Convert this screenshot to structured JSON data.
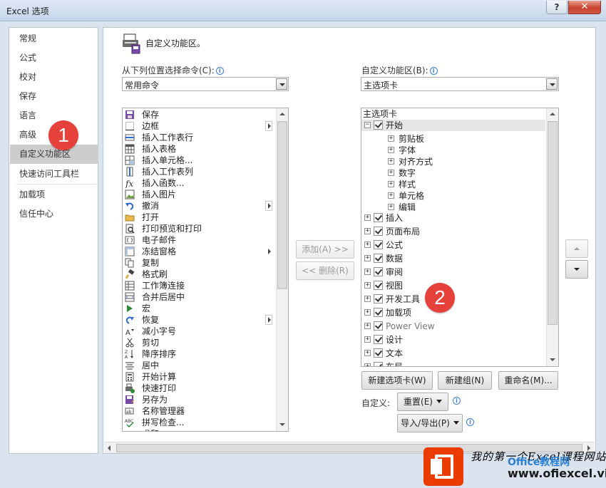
{
  "window": {
    "title": "Excel 选项",
    "help_label": "?",
    "close_label": "✕"
  },
  "nav": {
    "items": [
      {
        "label": "常规",
        "selected": false
      },
      {
        "label": "公式",
        "selected": false
      },
      {
        "label": "校对",
        "selected": false
      },
      {
        "label": "保存",
        "selected": false
      },
      {
        "label": "语言",
        "selected": false
      },
      {
        "label": "高级",
        "selected": false
      },
      {
        "label": "自定义功能区",
        "selected": true
      },
      {
        "label": "快速访问工具栏",
        "selected": false
      },
      {
        "label": "加载项",
        "selected": false
      },
      {
        "label": "信任中心",
        "selected": false
      }
    ]
  },
  "header": {
    "title": "自定义功能区。"
  },
  "left": {
    "label": "从下列位置选择命令(C):",
    "selected_source": "常用命令",
    "commands": [
      {
        "label": "保存",
        "icon": "save-icon",
        "submenu": false
      },
      {
        "label": "边框",
        "icon": "border-icon",
        "submenu": true
      },
      {
        "label": "插入工作表行",
        "icon": "insert-row-icon",
        "submenu": false
      },
      {
        "label": "插入表格",
        "icon": "table-icon",
        "submenu": false
      },
      {
        "label": "插入单元格...",
        "icon": "insert-cell-icon",
        "submenu": false
      },
      {
        "label": "插入工作表列",
        "icon": "insert-column-icon",
        "submenu": false
      },
      {
        "label": "插入函数...",
        "icon": "function-icon",
        "submenu": false
      },
      {
        "label": "插入图片",
        "icon": "picture-icon",
        "submenu": false
      },
      {
        "label": "撤消",
        "icon": "undo-icon",
        "submenu": true
      },
      {
        "label": "打开",
        "icon": "open-folder-icon",
        "submenu": false
      },
      {
        "label": "打印预览和打印",
        "icon": "print-preview-icon",
        "submenu": false
      },
      {
        "label": "电子邮件",
        "icon": "email-icon",
        "submenu": false
      },
      {
        "label": "冻结窗格",
        "icon": "freeze-panes-icon",
        "submenu": "arrow"
      },
      {
        "label": "复制",
        "icon": "copy-icon",
        "submenu": false
      },
      {
        "label": "格式刷",
        "icon": "format-painter-icon",
        "submenu": false
      },
      {
        "label": "工作簿连接",
        "icon": "connections-icon",
        "submenu": false
      },
      {
        "label": "合并后居中",
        "icon": "merge-center-icon",
        "submenu": false
      },
      {
        "label": "宏",
        "icon": "macro-icon",
        "submenu": false
      },
      {
        "label": "恢复",
        "icon": "redo-icon",
        "submenu": true
      },
      {
        "label": "减小字号",
        "icon": "decrease-font-icon",
        "submenu": false
      },
      {
        "label": "剪切",
        "icon": "cut-icon",
        "submenu": false
      },
      {
        "label": "降序排序",
        "icon": "sort-desc-icon",
        "submenu": false
      },
      {
        "label": "居中",
        "icon": "center-align-icon",
        "submenu": false
      },
      {
        "label": "开始计算",
        "icon": "calculate-icon",
        "submenu": false
      },
      {
        "label": "快速打印",
        "icon": "quick-print-icon",
        "submenu": false
      },
      {
        "label": "另存为",
        "icon": "save-as-icon",
        "submenu": false
      },
      {
        "label": "名称管理器",
        "icon": "name-manager-icon",
        "submenu": false
      },
      {
        "label": "拼写检查...",
        "icon": "spelling-icon",
        "submenu": false
      },
      {
        "label": "求和",
        "icon": "sum-icon",
        "submenu": false
      }
    ]
  },
  "middle": {
    "add_label": "添加(A) >>",
    "remove_label": "<< 删除(R)"
  },
  "right": {
    "label": "自定义功能区(B):",
    "selected_scope": "主选项卡",
    "tree_header": "主选项卡",
    "tree": [
      {
        "label": "开始",
        "level": 0,
        "expand": "−",
        "checked": true,
        "highlight": true
      },
      {
        "label": "剪贴板",
        "level": 1,
        "expand": "+",
        "checked": null
      },
      {
        "label": "字体",
        "level": 1,
        "expand": "+",
        "checked": null
      },
      {
        "label": "对齐方式",
        "level": 1,
        "expand": "+",
        "checked": null
      },
      {
        "label": "数字",
        "level": 1,
        "expand": "+",
        "checked": null
      },
      {
        "label": "样式",
        "level": 1,
        "expand": "+",
        "checked": null
      },
      {
        "label": "单元格",
        "level": 1,
        "expand": "+",
        "checked": null
      },
      {
        "label": "编辑",
        "level": 1,
        "expand": "+",
        "checked": null
      },
      {
        "label": "插入",
        "level": 0,
        "expand": "+",
        "checked": true
      },
      {
        "label": "页面布局",
        "level": 0,
        "expand": "+",
        "checked": true
      },
      {
        "label": "公式",
        "level": 0,
        "expand": "+",
        "checked": true
      },
      {
        "label": "数据",
        "level": 0,
        "expand": "+",
        "checked": true
      },
      {
        "label": "审阅",
        "level": 0,
        "expand": "+",
        "checked": true
      },
      {
        "label": "视图",
        "level": 0,
        "expand": "+",
        "checked": true
      },
      {
        "label": "开发工具",
        "level": 0,
        "expand": "+",
        "checked": true
      },
      {
        "label": "加载项",
        "level": 0,
        "expand": "+",
        "checked": true
      },
      {
        "label": "Power View",
        "level": 0,
        "expand": "+",
        "checked": true,
        "faded": true
      },
      {
        "label": "设计",
        "level": 0,
        "expand": "+",
        "checked": true
      },
      {
        "label": "文本",
        "level": 0,
        "expand": "+",
        "checked": true
      },
      {
        "label": "布局",
        "level": 0,
        "expand": "+",
        "checked": true
      }
    ],
    "new_tab_label": "新建选项卡(W)",
    "new_group_label": "新建组(N)",
    "rename_label": "重命名(M)...",
    "customize_label": "自定义:",
    "reset_label": "重置(E)",
    "import_export_label": "导入/导出(P)"
  },
  "annotations": {
    "badge1": "1",
    "badge2": "2"
  },
  "watermark": {
    "line1": "我的第一个Excel课程网站",
    "line2": "www.ofiexcel.vip",
    "brand": "Office教程网"
  },
  "colors": {
    "nav_selected": "#cdcdcd",
    "badge": "#e5403a",
    "tree_highlight": "#e6e6e6"
  }
}
